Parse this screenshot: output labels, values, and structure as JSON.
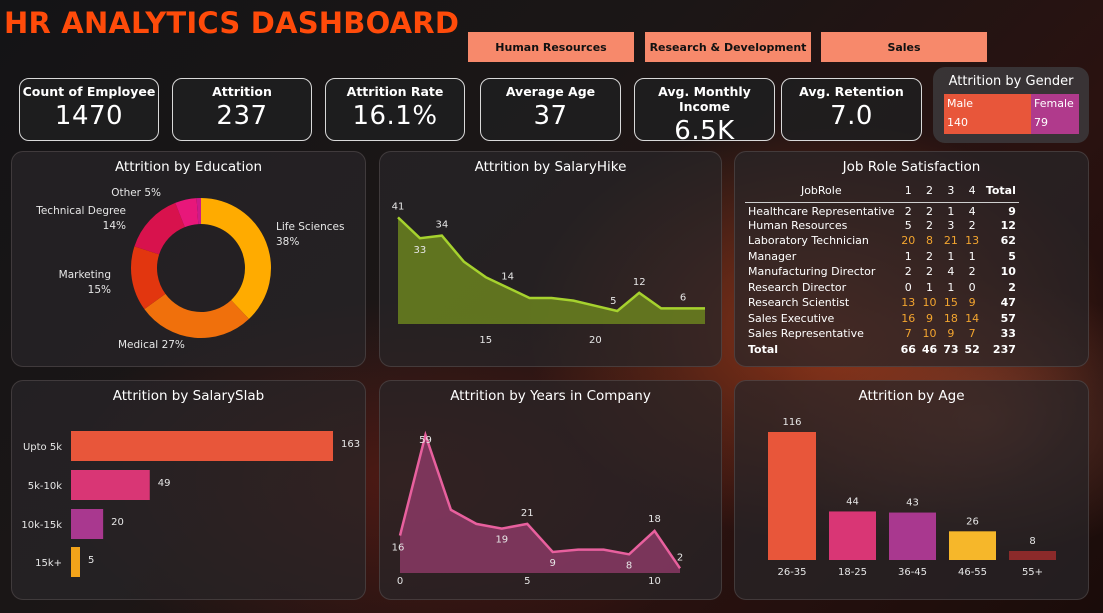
{
  "title": "HR ANALYTICS DASHBOARD",
  "departments": [
    "Human Resources",
    "Research & Development",
    "Sales"
  ],
  "kpis": [
    {
      "label": "Count of Employee",
      "value": "1470"
    },
    {
      "label": "Attrition",
      "value": "237"
    },
    {
      "label": "Attrition Rate",
      "value": "16.1%"
    },
    {
      "label": "Average Age",
      "value": "37"
    },
    {
      "label": "Avg. Monthly Income",
      "value": "6.5K"
    },
    {
      "label": "Avg. Retention",
      "value": "7.0"
    }
  ],
  "gender": {
    "title": "Attrition by Gender",
    "male_label": "Male",
    "male_value": "140",
    "female_label": "Female",
    "female_value": "79",
    "colors": {
      "male": "#e8563a",
      "female": "#b03a8c"
    }
  },
  "panels": {
    "education": "Attrition by Education",
    "salary_hike": "Attrition by SalaryHike",
    "job_role": "Job Role Satisfaction",
    "salary_slab": "Attrition by SalarySlab",
    "years": "Attrition by Years in Company",
    "age": "Attrition by Age"
  },
  "chart_data": [
    {
      "id": "education",
      "type": "pie",
      "title": "Attrition by Education",
      "categories": [
        "Life Sciences",
        "Medical",
        "Marketing",
        "Technical Degree",
        "Other",
        ""
      ],
      "values": [
        38,
        27,
        15,
        14,
        5,
        1
      ],
      "labels": [
        "Life Sciences\n38%",
        "Medical 27%",
        "Marketing\n15%",
        "Technical Degree\n14%",
        "Other 5%",
        ""
      ],
      "colors": [
        "#ffab00",
        "#f0700c",
        "#e2360f",
        "#d8124d",
        "#e8177a",
        "#cc1a8a"
      ]
    },
    {
      "id": "salary_hike",
      "type": "area",
      "title": "Attrition by SalaryHike",
      "x": [
        11,
        12,
        13,
        14,
        15,
        16,
        17,
        18,
        19,
        20,
        21,
        22,
        23,
        24,
        25
      ],
      "y": [
        41,
        33,
        34,
        24,
        18,
        14,
        10,
        10,
        9,
        7,
        5,
        12,
        6,
        6,
        6
      ],
      "point_labels": {
        "0": "41",
        "1": "33",
        "2": "34",
        "5": "14",
        "10": "5",
        "11": "12",
        "13": "6"
      },
      "xticks": [
        15,
        20
      ],
      "ylim": [
        0,
        45
      ],
      "color": "#a6d22e"
    },
    {
      "id": "salary_slab",
      "type": "bar",
      "title": "Attrition by SalarySlab",
      "categories": [
        "Upto 5k",
        "5k-10k",
        "10k-15k",
        "15k+"
      ],
      "values": [
        163,
        49,
        20,
        5
      ],
      "colors": [
        "#e8563a",
        "#d93675",
        "#a9388f",
        "#f2a31a"
      ]
    },
    {
      "id": "years",
      "type": "area",
      "title": "Attrition by Years in Company",
      "x": [
        0,
        1,
        2,
        3,
        4,
        5,
        6,
        7,
        8,
        9,
        10,
        11
      ],
      "y": [
        16,
        59,
        27,
        21,
        19,
        21,
        9,
        10,
        10,
        8,
        18,
        2
      ],
      "point_labels": {
        "0": "16",
        "1": "59",
        "4": "19",
        "5": "21",
        "6": "9",
        "9": "8",
        "10": "18",
        "11": "2"
      },
      "xticks": [
        0,
        5,
        10
      ],
      "ylim": [
        0,
        65
      ],
      "color": "#e8609e"
    },
    {
      "id": "age",
      "type": "bar",
      "title": "Attrition by Age",
      "categories": [
        "26-35",
        "18-25",
        "36-45",
        "46-55",
        "55+"
      ],
      "values": [
        116,
        44,
        43,
        26,
        8
      ],
      "colors": [
        "#e8563a",
        "#d93675",
        "#a9388f",
        "#f6b72a",
        "#8b2a2a"
      ]
    }
  ],
  "job_role": {
    "headers": [
      "JobRole",
      "1",
      "2",
      "3",
      "4",
      "Total"
    ],
    "rows": [
      [
        "Healthcare Representative",
        "2",
        "2",
        "1",
        "4",
        "9"
      ],
      [
        "Human Resources",
        "5",
        "2",
        "3",
        "2",
        "12"
      ],
      [
        "Laboratory Technician",
        "20",
        "8",
        "21",
        "13",
        "62"
      ],
      [
        "Manager",
        "1",
        "2",
        "1",
        "1",
        "5"
      ],
      [
        "Manufacturing Director",
        "2",
        "2",
        "4",
        "2",
        "10"
      ],
      [
        "Research Director",
        "0",
        "1",
        "1",
        "0",
        "2"
      ],
      [
        "Research Scientist",
        "13",
        "10",
        "15",
        "9",
        "47"
      ],
      [
        "Sales Executive",
        "16",
        "9",
        "18",
        "14",
        "57"
      ],
      [
        "Sales Representative",
        "7",
        "10",
        "9",
        "7",
        "33"
      ]
    ],
    "total": [
      "Total",
      "66",
      "46",
      "73",
      "52",
      "237"
    ],
    "highlight_color": "#f3a52f"
  }
}
